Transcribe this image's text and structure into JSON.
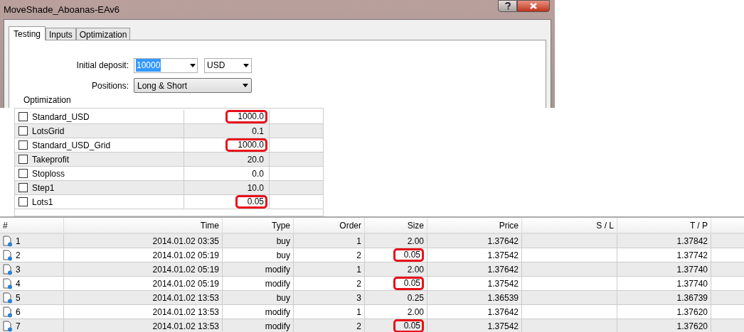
{
  "window": {
    "title": "MoveShade_Aboanas-EAv6"
  },
  "tabs": [
    {
      "label": "Testing",
      "selected": true
    },
    {
      "label": "Inputs",
      "selected": false
    },
    {
      "label": "Optimization",
      "selected": false
    }
  ],
  "form": {
    "deposit_label": "Initial deposit:",
    "deposit_value": "10000",
    "currency": "USD",
    "positions_label": "Positions:",
    "positions_value": "Long & Short",
    "group_label": "Optimization"
  },
  "inputs": [
    {
      "name": "Standard_USD",
      "checked": false,
      "value": "1000.0",
      "highlighted": true
    },
    {
      "name": "LotsGrid",
      "checked": false,
      "value": "0.1",
      "highlighted": false
    },
    {
      "name": "Standard_USD_Grid",
      "checked": false,
      "value": "1000.0",
      "highlighted": true
    },
    {
      "name": "Takeprofit",
      "checked": false,
      "value": "20.0",
      "highlighted": false
    },
    {
      "name": "Stoploss",
      "checked": false,
      "value": "0.0",
      "highlighted": false
    },
    {
      "name": "Step1",
      "checked": false,
      "value": "10.0",
      "highlighted": false
    },
    {
      "name": "Lots1",
      "checked": false,
      "value": "0.05",
      "highlighted": true
    }
  ],
  "orders": {
    "columns": [
      "#",
      "Time",
      "Type",
      "Order",
      "Size",
      "Price",
      "S / L",
      "T / P"
    ],
    "rows": [
      {
        "n": "1",
        "time": "2014.01.02 03:35",
        "type": "buy",
        "order": "1",
        "size": "2.00",
        "size_highlighted": false,
        "price": "1.37642",
        "tp": "1.37842"
      },
      {
        "n": "2",
        "time": "2014.01.02 05:19",
        "type": "buy",
        "order": "2",
        "size": "0.05",
        "size_highlighted": true,
        "price": "1.37542",
        "tp": "1.37742"
      },
      {
        "n": "3",
        "time": "2014.01.02 05:19",
        "type": "modify",
        "order": "1",
        "size": "2.00",
        "size_highlighted": false,
        "price": "1.37642",
        "tp": "1.37740"
      },
      {
        "n": "4",
        "time": "2014.01.02 05:19",
        "type": "modify",
        "order": "2",
        "size": "0.05",
        "size_highlighted": true,
        "price": "1.37542",
        "tp": "1.37740"
      },
      {
        "n": "5",
        "time": "2014.01.02 13:53",
        "type": "buy",
        "order": "3",
        "size": "0.25",
        "size_highlighted": false,
        "price": "1.36539",
        "tp": "1.36739"
      },
      {
        "n": "6",
        "time": "2014.01.02 13:53",
        "type": "modify",
        "order": "1",
        "size": "2.00",
        "size_highlighted": false,
        "price": "1.37642",
        "tp": "1.37620"
      },
      {
        "n": "7",
        "time": "2014.01.02 13:53",
        "type": "modify",
        "order": "2",
        "size": "0.05",
        "size_highlighted": true,
        "price": "1.37542",
        "tp": "1.37620"
      }
    ]
  }
}
